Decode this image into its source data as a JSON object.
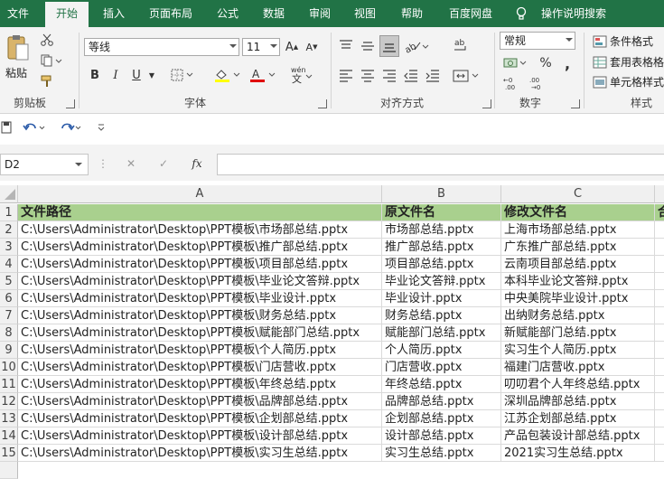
{
  "ribbon_tabs": [
    "文件",
    "开始",
    "插入",
    "页面布局",
    "公式",
    "数据",
    "审阅",
    "视图",
    "帮助",
    "百度网盘",
    "操作说明搜索"
  ],
  "active_tab": "开始",
  "groups": {
    "clipboard": {
      "label": "剪贴板",
      "paste_label": "粘贴"
    },
    "font": {
      "label": "字体",
      "font_name": "等线",
      "font_size": "11",
      "bold": "B",
      "italic": "I",
      "underline": "U"
    },
    "alignment": {
      "label": "对齐方式"
    },
    "number": {
      "label": "数字",
      "format": "常规"
    },
    "styles": {
      "label": "样式",
      "items": [
        "条件格式",
        "套用表格格式",
        "单元格样式"
      ]
    }
  },
  "formula_bar": {
    "name_box": "D2",
    "fx": "fx",
    "formula": ""
  },
  "columns": [
    "A",
    "B",
    "C"
  ],
  "col_d_partial": "合",
  "rows": [
    {
      "n": "1",
      "a": "文件路径",
      "b": "原文件名",
      "c": "修改文件名"
    },
    {
      "n": "2",
      "a": "C:\\Users\\Administrator\\Desktop\\PPT模板\\市场部总结.pptx",
      "b": "市场部总结.pptx",
      "c": "上海市场部总结.pptx"
    },
    {
      "n": "3",
      "a": "C:\\Users\\Administrator\\Desktop\\PPT模板\\推广部总结.pptx",
      "b": "推广部总结.pptx",
      "c": "广东推广部总结.pptx"
    },
    {
      "n": "4",
      "a": "C:\\Users\\Administrator\\Desktop\\PPT模板\\项目部总结.pptx",
      "b": "项目部总结.pptx",
      "c": "云南项目部总结.pptx"
    },
    {
      "n": "5",
      "a": "C:\\Users\\Administrator\\Desktop\\PPT模板\\毕业论文答辩.pptx",
      "b": "毕业论文答辩.pptx",
      "c": "本科毕业论文答辩.pptx"
    },
    {
      "n": "6",
      "a": "C:\\Users\\Administrator\\Desktop\\PPT模板\\毕业设计.pptx",
      "b": "毕业设计.pptx",
      "c": "中央美院毕业设计.pptx"
    },
    {
      "n": "7",
      "a": "C:\\Users\\Administrator\\Desktop\\PPT模板\\财务总结.pptx",
      "b": "财务总结.pptx",
      "c": "出纳财务总结.pptx"
    },
    {
      "n": "8",
      "a": "C:\\Users\\Administrator\\Desktop\\PPT模板\\赋能部门总结.pptx",
      "b": "赋能部门总结.pptx",
      "c": "新赋能部门总结.pptx"
    },
    {
      "n": "9",
      "a": "C:\\Users\\Administrator\\Desktop\\PPT模板\\个人简历.pptx",
      "b": "个人简历.pptx",
      "c": "实习生个人简历.pptx"
    },
    {
      "n": "10",
      "a": "C:\\Users\\Administrator\\Desktop\\PPT模板\\门店营收.pptx",
      "b": "门店营收.pptx",
      "c": "福建门店营收.pptx"
    },
    {
      "n": "11",
      "a": "C:\\Users\\Administrator\\Desktop\\PPT模板\\年终总结.pptx",
      "b": "年终总结.pptx",
      "c": "叨叨君个人年终总结.pptx"
    },
    {
      "n": "12",
      "a": "C:\\Users\\Administrator\\Desktop\\PPT模板\\品牌部总结.pptx",
      "b": "品牌部总结.pptx",
      "c": "深圳品牌部总结.pptx"
    },
    {
      "n": "13",
      "a": "C:\\Users\\Administrator\\Desktop\\PPT模板\\企划部总结.pptx",
      "b": "企划部总结.pptx",
      "c": "江苏企划部总结.pptx"
    },
    {
      "n": "14",
      "a": "C:\\Users\\Administrator\\Desktop\\PPT模板\\设计部总结.pptx",
      "b": "设计部总结.pptx",
      "c": "产品包装设计部总结.pptx"
    },
    {
      "n": "15",
      "a": "C:\\Users\\Administrator\\Desktop\\PPT模板\\实习生总结.pptx",
      "b": "实习生总结.pptx",
      "c": "2021实习生总结.pptx"
    }
  ],
  "colors": {
    "brand": "#217346",
    "header_fill": "#a9d08e"
  }
}
